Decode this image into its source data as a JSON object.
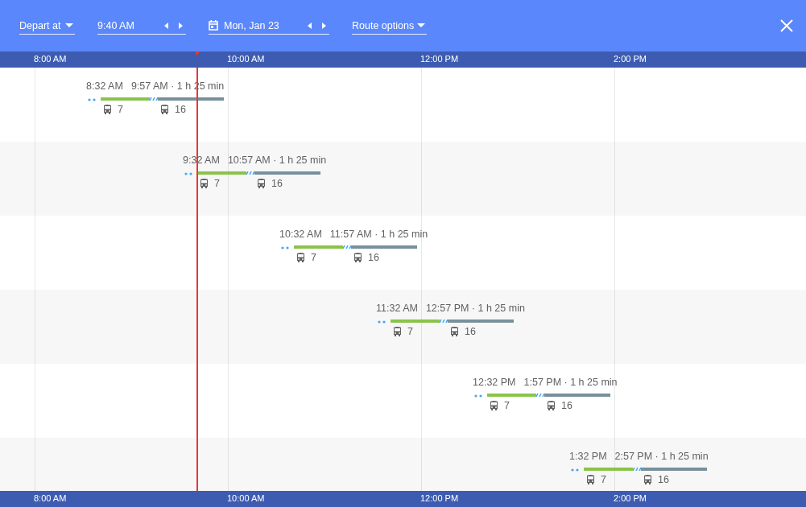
{
  "toolbar": {
    "depart_mode": "Depart at",
    "time": "9:40 AM",
    "date": "Mon, Jan 23",
    "route_options": "Route options"
  },
  "axis_top": [
    "8:00 AM",
    "10:00 AM",
    "12:00 PM",
    "2:00 PM"
  ],
  "trips": [
    {
      "depart": "8:32 AM",
      "summary": "9:57 AM · 1 h 25 min",
      "legs": [
        {
          "route": "7",
          "color": "#8bc34a"
        },
        {
          "route": "16",
          "color": "#78909c"
        }
      ]
    },
    {
      "depart": "9:32 AM",
      "summary": "10:57 AM · 1 h 25 min",
      "legs": [
        {
          "route": "7",
          "color": "#8bc34a"
        },
        {
          "route": "16",
          "color": "#78909c"
        }
      ]
    },
    {
      "depart": "10:32 AM",
      "summary": "11:57 AM · 1 h 25 min",
      "legs": [
        {
          "route": "7",
          "color": "#8bc34a"
        },
        {
          "route": "16",
          "color": "#78909c"
        }
      ]
    },
    {
      "depart": "11:32 AM",
      "summary": "12:57 PM · 1 h 25 min",
      "legs": [
        {
          "route": "7",
          "color": "#8bc34a"
        },
        {
          "route": "16",
          "color": "#78909c"
        }
      ]
    },
    {
      "depart": "12:32 PM",
      "summary": "1:57 PM · 1 h 25 min",
      "legs": [
        {
          "route": "7",
          "color": "#8bc34a"
        },
        {
          "route": "16",
          "color": "#78909c"
        }
      ]
    },
    {
      "depart": "1:32 PM",
      "summary": "2:57 PM · 1 h 25 min",
      "legs": [
        {
          "route": "7",
          "color": "#8bc34a"
        },
        {
          "route": "16",
          "color": "#78909c"
        }
      ]
    }
  ],
  "axis_bottom": [
    "8:00 AM",
    "10:00 AM",
    "12:00 PM",
    "2:00 PM"
  ]
}
